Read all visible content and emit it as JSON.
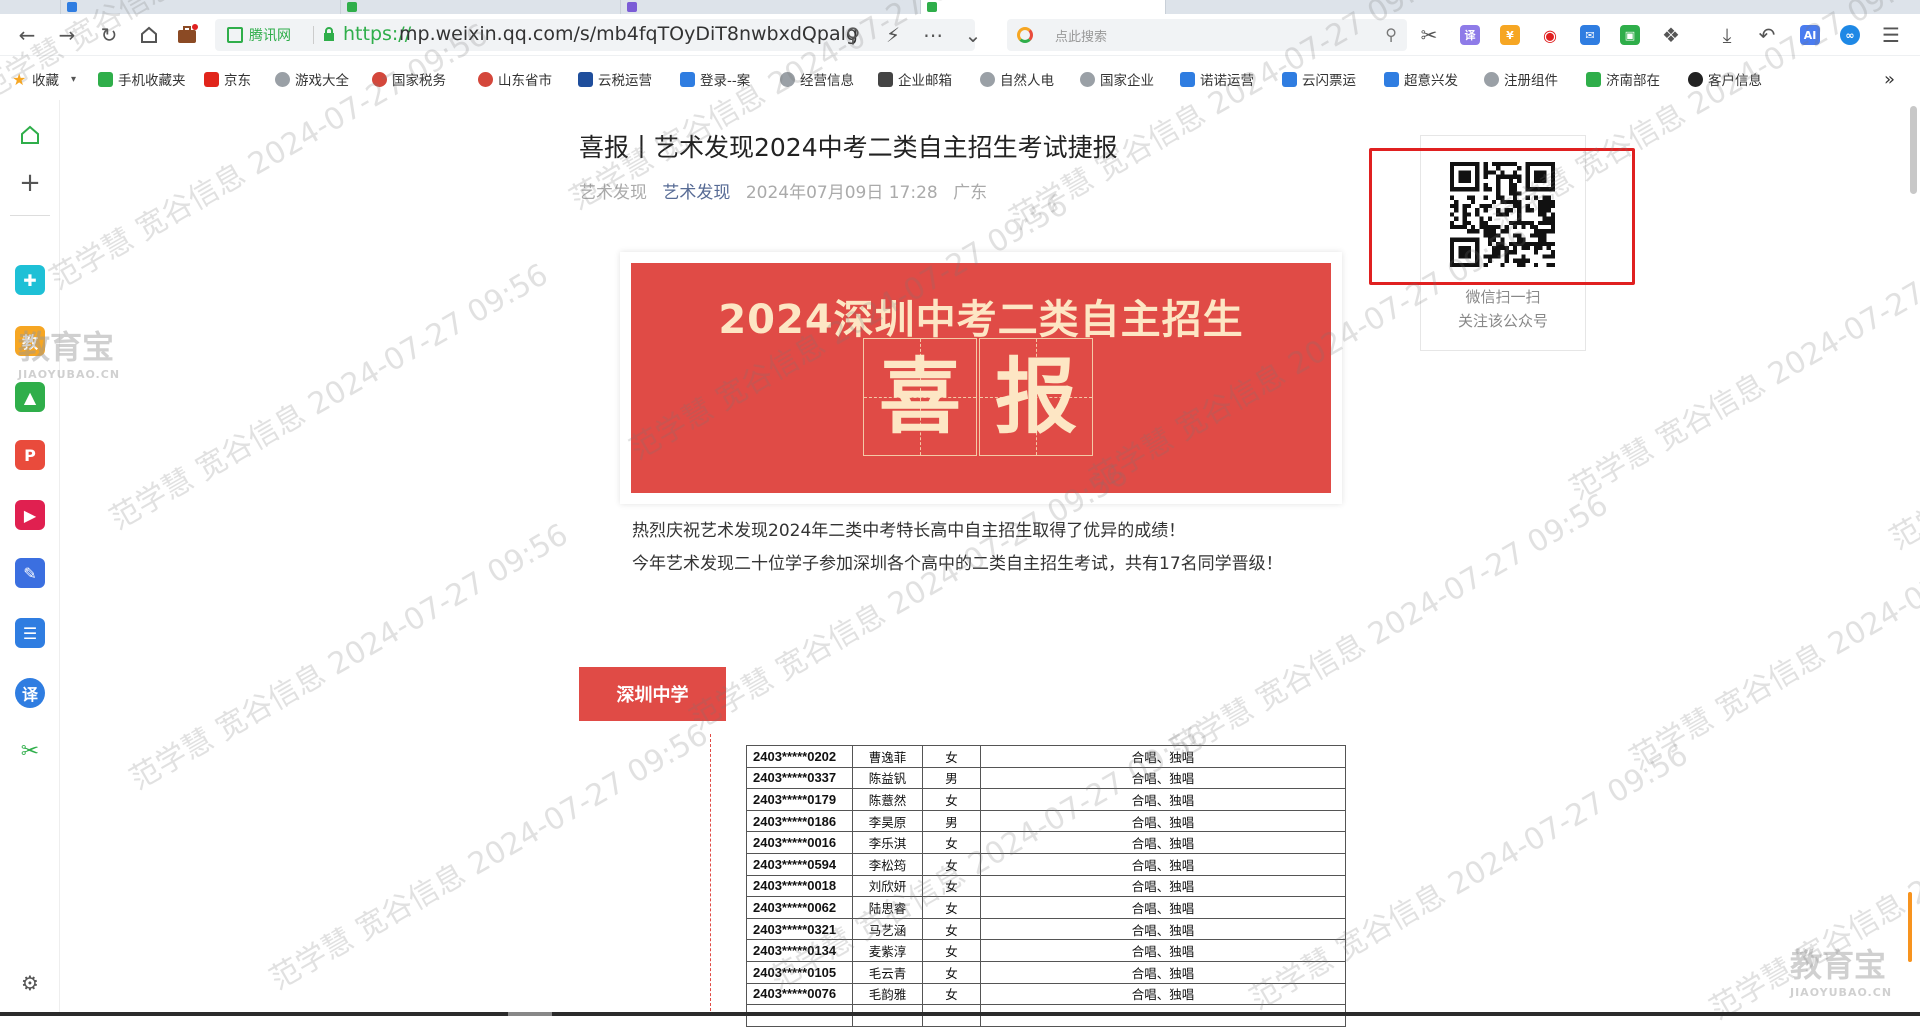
{
  "browser": {
    "url_site_name": "腾讯网",
    "url_protocol": "https://",
    "url_host": "mp.weixin.qq.com/s/mb4fqTOyDiT8nwbxdQpalg",
    "search_placeholder": "点此搜索",
    "accent_green": "#2fae4a"
  },
  "bookmarks": [
    {
      "label": "收藏",
      "icon": "star-icon",
      "color": "#f6a623"
    },
    {
      "label": "手机收藏夹",
      "icon": "phone-icon",
      "color": "#2fae4a"
    },
    {
      "label": "京东",
      "icon": "jd-icon",
      "color": "#e1251b"
    },
    {
      "label": "游戏大全",
      "icon": "globe-icon",
      "color": "#9aa0a6"
    },
    {
      "label": "国家税务",
      "icon": "emblem-icon",
      "color": "#d4473b"
    },
    {
      "label": "山东省市",
      "icon": "emblem-icon",
      "color": "#d4473b"
    },
    {
      "label": "云税运营",
      "icon": "asm-icon",
      "color": "#1f4e9c"
    },
    {
      "label": "登录--案",
      "icon": "cloud-icon",
      "color": "#2f7de1"
    },
    {
      "label": "经营信息",
      "icon": "globe-icon",
      "color": "#9aa0a6"
    },
    {
      "label": "企业邮箱",
      "icon": "mail-icon",
      "color": "#444"
    },
    {
      "label": "自然人电",
      "icon": "globe-icon",
      "color": "#9aa0a6"
    },
    {
      "label": "国家企业",
      "icon": "globe-icon",
      "color": "#9aa0a6"
    },
    {
      "label": "诺诺运营",
      "icon": "users-icon",
      "color": "#2f7de1"
    },
    {
      "label": "云闪票运",
      "icon": "cloud-icon",
      "color": "#2f7de1"
    },
    {
      "label": "超意兴发",
      "icon": "cloud-icon",
      "color": "#2f7de1"
    },
    {
      "label": "注册组件",
      "icon": "globe-icon",
      "color": "#9aa0a6"
    },
    {
      "label": "济南部在",
      "icon": "grid-icon",
      "color": "#2fae4a"
    },
    {
      "label": "客户信息",
      "icon": "circle-icon",
      "color": "#222"
    }
  ],
  "bookmarks_more": "»",
  "article": {
    "title": "喜报丨艺术发现2024中考二类自主招生考试捷报",
    "source": "艺术发现",
    "account": "艺术发现",
    "datetime": "2024年07月09日 17:28",
    "location": "广东",
    "banner_title": "2024深圳中考二类自主招生",
    "banner_char1": "喜",
    "banner_char2": "报",
    "para1": "热烈庆祝艺术发现2024年二类中考特长高中自主招生取得了优异的成绩！",
    "para2": "今年艺术发现二十位学子参加深圳各个高中的二类自主招生考试，共有17名同学晋级！",
    "section_tag": "深圳中学",
    "banner_color": "#e04b46"
  },
  "qr": {
    "caption_line1": "微信扫一扫",
    "caption_line2": "关注该公众号"
  },
  "table": {
    "rows": [
      {
        "id": "2403*****0202",
        "name": "曹逸菲",
        "gender": "女",
        "item": "合唱、独唱"
      },
      {
        "id": "2403*****0337",
        "name": "陈益钒",
        "gender": "男",
        "item": "合唱、独唱"
      },
      {
        "id": "2403*****0179",
        "name": "陈薏然",
        "gender": "女",
        "item": "合唱、独唱"
      },
      {
        "id": "2403*****0186",
        "name": "李昊原",
        "gender": "男",
        "item": "合唱、独唱"
      },
      {
        "id": "2403*****0016",
        "name": "李乐淇",
        "gender": "女",
        "item": "合唱、独唱"
      },
      {
        "id": "2403*****0594",
        "name": "李松筠",
        "gender": "女",
        "item": "合唱、独唱"
      },
      {
        "id": "2403*****0018",
        "name": "刘欣妍",
        "gender": "女",
        "item": "合唱、独唱"
      },
      {
        "id": "2403*****0062",
        "name": "陆思睿",
        "gender": "女",
        "item": "合唱、独唱"
      },
      {
        "id": "2403*****0321",
        "name": "马艺涵",
        "gender": "女",
        "item": "合唱、独唱"
      },
      {
        "id": "2403*****0134",
        "name": "麦紫淳",
        "gender": "女",
        "item": "合唱、独唱"
      },
      {
        "id": "2403*****0105",
        "name": "毛云青",
        "gender": "女",
        "item": "合唱、独唱"
      },
      {
        "id": "2403*****0076",
        "name": "毛韵雅",
        "gender": "女",
        "item": "合唱、独唱"
      }
    ]
  },
  "watermark": {
    "text": "范学慧 宽谷信息 2024-07-27 09:56",
    "logo_main": "教育宝",
    "logo_sub": "JIAOYUBAO.CN"
  }
}
